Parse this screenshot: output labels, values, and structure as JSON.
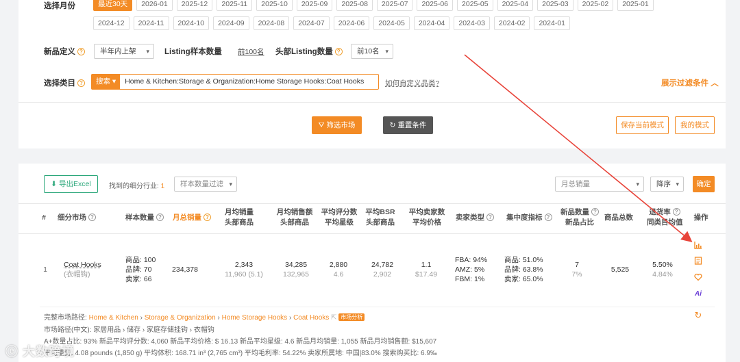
{
  "filters": {
    "month_label": "选择月份",
    "months_row1": [
      "最近30天",
      "2026-01",
      "2025-12",
      "2025-11",
      "2025-10",
      "2025-09",
      "2025-08",
      "2025-07",
      "2025-06",
      "2025-05",
      "2025-04",
      "2025-03",
      "2025-02",
      "2025-01"
    ],
    "months_row2": [
      "2024-12",
      "2024-11",
      "2024-10",
      "2024-09",
      "2024-08",
      "2024-07",
      "2024-06",
      "2024-05",
      "2024-04",
      "2024-03",
      "2024-02",
      "2024-01"
    ],
    "active_month": "最近30天",
    "new_def_label": "新品定义",
    "new_def_value": "半年内上架",
    "listing_sample_label": "Listing样本数量",
    "listing_sample_value": "前100名",
    "head_listing_label": "头部Listing数量",
    "head_listing_value": "前10名",
    "category_label": "选择类目",
    "search_btn": "搜索",
    "category_value": "Home & Kitchen:Storage & Organization:Home Storage Hooks:Coat Hooks",
    "custom_category_link": "如何自定义品类?",
    "show_filter": "展示过滤条件"
  },
  "actions": {
    "filter_market": "筛选市场",
    "reset": "重置条件",
    "save_mode": "保存当前模式",
    "my_mode": "我的模式"
  },
  "toolbar": {
    "export": "导出Excel",
    "found_label": "找到的细分行业:",
    "found_count": "1",
    "sample_filter": "样本数量过滤",
    "sort_field": "月总销量",
    "sort_order": "降序",
    "confirm": "确定"
  },
  "table": {
    "headers": {
      "index": "#",
      "market": "细分市场",
      "sample": "样本数量",
      "monthly_sales": "月总销量",
      "avg_sales_1": "月均销量",
      "avg_sales_2": "头部商品",
      "avg_revenue_1": "月均销售额",
      "avg_revenue_2": "头部商品",
      "avg_reviews_1": "平均评分数",
      "avg_reviews_2": "平均星级",
      "avg_bsr_1": "平均BSR",
      "avg_bsr_2": "头部商品",
      "avg_sellers_1": "平均卖家数",
      "avg_sellers_2": "平均价格",
      "seller_type": "卖家类型",
      "concentration": "集中度指标",
      "new_count_1": "新品数量",
      "new_count_2": "新品占比",
      "total_products": "商品总数",
      "return_1": "退货率",
      "return_2": "同类目均值",
      "ops": "操作"
    },
    "row": {
      "index": "1",
      "market_en": "Coat Hooks",
      "market_cn": "(衣帽钩)",
      "sample_products": "商品: 100",
      "sample_brands": "品牌: 70",
      "sample_sellers": "卖家: 66",
      "monthly_sales": "234,378",
      "avg_sales": "2,343",
      "avg_sales_head": "11,960 (5.1)",
      "avg_revenue": "34,285",
      "avg_revenue_head": "132,965",
      "avg_reviews": "2,880",
      "avg_stars": "4.6",
      "avg_bsr": "24,782",
      "avg_bsr_head": "2,902",
      "avg_sellers": "1.1",
      "avg_price": "$17.49",
      "fba": "FBA: 94%",
      "amz": "AMZ: 5%",
      "fbm": "FBM: 1%",
      "conc_products": "商品: 51.0%",
      "conc_brands": "品牌: 63.8%",
      "conc_sellers": "卖家: 65.0%",
      "new_count": "7",
      "new_ratio": "7%",
      "total_products": "5,525",
      "return_rate": "5.50%",
      "return_avg": "4.84%"
    }
  },
  "details": {
    "full_path_label": "完整市场路径:",
    "full_path": [
      "Home & Kitchen",
      "Storage & Organization",
      "Home Storage Hooks",
      "Coat Hooks"
    ],
    "market_analysis_tag": "市场分析",
    "cn_path": "市场路径(中文): 家居用品 › 储存 › 家庭存储挂钩 › 衣帽钩",
    "stats_line": "A+数量占比: 93%   新品平均评分数: 4,060   新品平均价格: $ 16.13   新品平均星级: 4.6   新品月均销量: 1,055   新品月均销售额: $15,607",
    "weight_line": "平均重量: 4.08 pounds (1,850 g)   平均体积: 168.71 in³ (2,765 cm³)   平均毛利率: 54.22%   卖家所属地: 中国|83.0%   搜索购买比: 6.9‰"
  },
  "watermark": "大数跨境",
  "colors": {
    "accent": "#f38b25",
    "export_green": "#2aa77a",
    "arrow_red": "#e8443a"
  }
}
